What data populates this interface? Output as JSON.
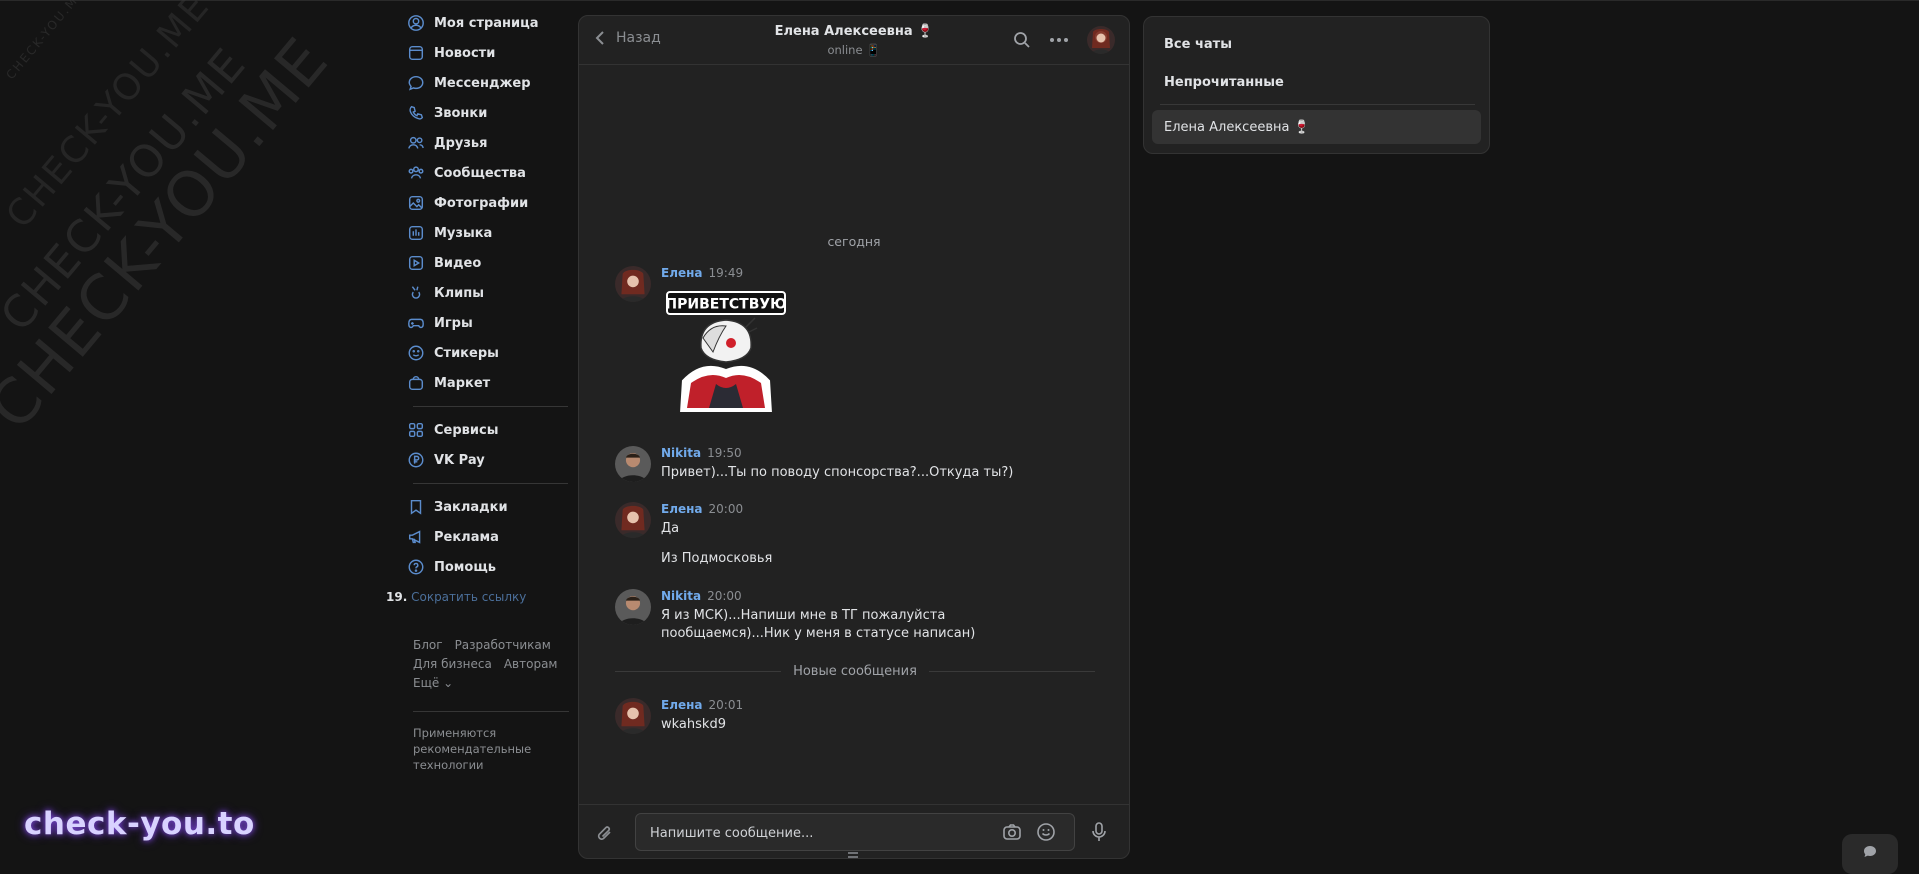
{
  "watermark": {
    "large": "CHECK-YOU.ME",
    "small": "CHECK-YOU.ME",
    "bottom": "check-you.to"
  },
  "nav": {
    "items": [
      {
        "label": "Моя страница",
        "icon": "user-circle-icon"
      },
      {
        "label": "Новости",
        "icon": "news-icon"
      },
      {
        "label": "Мессенджер",
        "icon": "chat-bubble-icon"
      },
      {
        "label": "Звонки",
        "icon": "phone-icon"
      },
      {
        "label": "Друзья",
        "icon": "friends-icon"
      },
      {
        "label": "Сообщества",
        "icon": "communities-icon"
      },
      {
        "label": "Фотографии",
        "icon": "photo-icon"
      },
      {
        "label": "Музыка",
        "icon": "music-icon"
      },
      {
        "label": "Видео",
        "icon": "video-icon"
      },
      {
        "label": "Клипы",
        "icon": "clips-icon"
      },
      {
        "label": "Игры",
        "icon": "gamepad-icon"
      },
      {
        "label": "Стикеры",
        "icon": "smile-icon"
      },
      {
        "label": "Маркет",
        "icon": "bag-icon"
      }
    ],
    "items2": [
      {
        "label": "Сервисы",
        "icon": "grid-icon"
      },
      {
        "label": "VK Pay",
        "icon": "ruble-icon"
      }
    ],
    "items3": [
      {
        "label": "Закладки",
        "icon": "bookmark-icon"
      },
      {
        "label": "Реклама",
        "icon": "megaphone-icon"
      },
      {
        "label": "Помощь",
        "icon": "help-icon"
      }
    ],
    "shorten_num": "19.",
    "shorten_label": "Сократить ссылку",
    "footer": {
      "blog": "Блог",
      "devs": "Разработчикам",
      "business": "Для бизнеса",
      "authors": "Авторам",
      "more": "Ещё ⌄"
    },
    "recommend": "Применяются рекомендательные технологии"
  },
  "chat": {
    "back_label": "Назад",
    "peer_name": "Елена Алексеевна 🍷",
    "peer_status": "online 📱",
    "date_label": "сегодня",
    "new_messages_label": "Новые сообщения",
    "sticker_text": "ПРИВЕТСТВУЮ",
    "messages": [
      {
        "author": "Елена",
        "time": "19:49",
        "lines": []
      },
      {
        "author": "Nikita",
        "time": "19:50",
        "lines": [
          "Привет)...Ты по поводу спонсорства?...Откуда ты?)"
        ]
      },
      {
        "author": "Елена",
        "time": "20:00",
        "lines": [
          "Да"
        ],
        "extra": "Из Подмосковья"
      },
      {
        "author": "Nikita",
        "time": "20:00",
        "lines": [
          "Я из МСК)...Напиши мне в ТГ пожалуйста",
          "пообщаемся)...Ник у меня в статусе написан)"
        ]
      },
      {
        "author": "Елена",
        "time": "20:01",
        "lines": [
          "wkahskd9"
        ]
      }
    ],
    "input_placeholder": "Напишите сообщение..."
  },
  "chats_panel": {
    "all": "Все чаты",
    "unread": "Непрочитанные",
    "active_chat": "Елена Алексеевна 🍷"
  },
  "colors": {
    "accent": "#71aaeb",
    "icon": "#5b8ccc",
    "bg": "#141414",
    "panel": "#222222"
  }
}
